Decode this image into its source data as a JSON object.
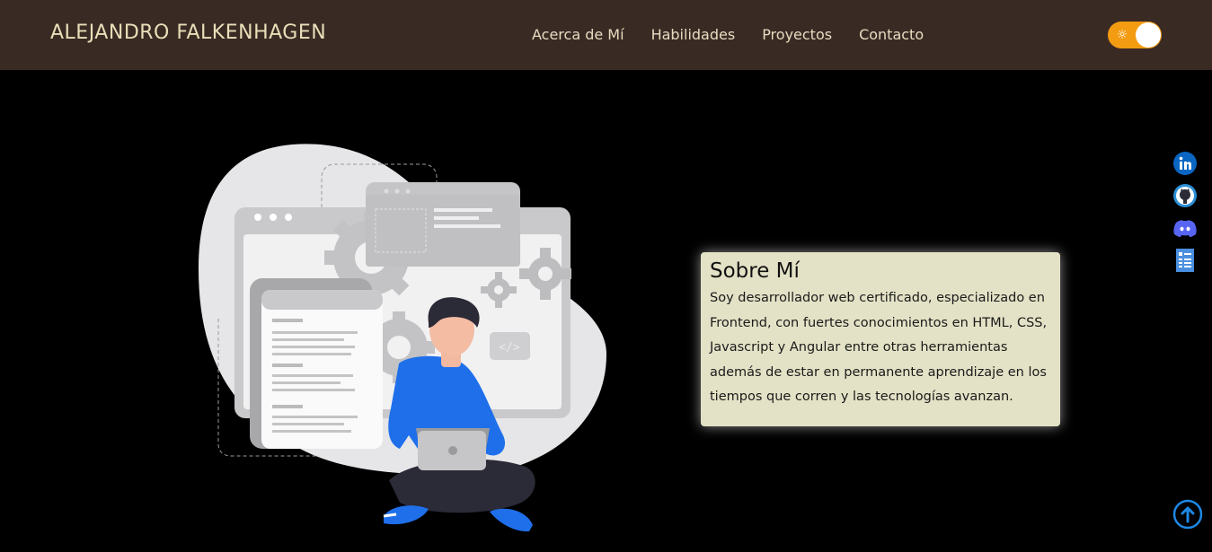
{
  "navbar": {
    "brand": "ALEJANDRO FALKENHAGEN",
    "links": [
      "Acerca de Mí",
      "Habilidades",
      "Proyectos",
      "Contacto"
    ],
    "theme_toggle": {
      "icon": "sun-icon",
      "accent": "#f39c12"
    }
  },
  "about": {
    "title": "Sobre Mí",
    "text": "Soy desarrollador web certificado, especializado en Frontend, con fuertes conocimientos en HTML, CSS, Javascript y Angular entre otras herramientas además de estar en permanente aprendizaje en los tiempos que corren y las tecnologías avanzan."
  },
  "social": {
    "icons": [
      "linkedin-icon",
      "github-icon",
      "discord-icon",
      "resume-icon"
    ],
    "colors": {
      "linkedin": "#0a66c2",
      "github": "#2b8fd6",
      "discord": "#5865f2",
      "resume": "#4a8fe0"
    }
  },
  "scroll_top": {
    "icon": "arrow-up-icon",
    "color": "#1e88e5"
  },
  "colors": {
    "navbar_bg": "#3a2a24",
    "brand": "#e9dfb8",
    "card_bg": "#e4e2c6"
  }
}
